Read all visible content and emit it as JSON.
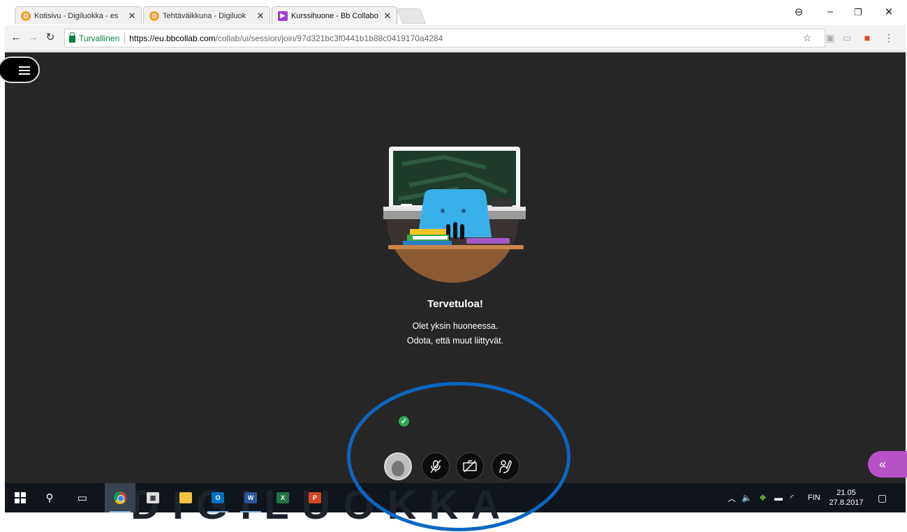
{
  "browser": {
    "tabs": [
      {
        "title": "Kotisivu - Digiluokka - es",
        "favicon": "digiluokka-icon"
      },
      {
        "title": "Tehtäväikkuna - Digiluok",
        "favicon": "digiluokka-icon"
      },
      {
        "title": "Kurssihuone - Bb Collabo",
        "favicon": "bb-collaborate-icon",
        "active": true
      }
    ],
    "close_glyph": "✕",
    "security_label": "Turvallinen",
    "url_host": "https://eu.bbcollab.com",
    "url_path": "/collab/ui/session/join/97d321bc3f0441b1b88c0419170a4284"
  },
  "collaborate": {
    "welcome_title": "Tervetuloa!",
    "welcome_line1": "Olet yksin huoneessa.",
    "welcome_line2": "Odota, että muut liittyvät.",
    "controls": [
      "avatar",
      "microphone-muted",
      "camera-off",
      "raise-hand"
    ],
    "panel_toggle": "«"
  },
  "taskbar": {
    "watermark": "DIGILUOKKA",
    "apps": [
      "chrome",
      "calculator",
      "file-explorer",
      "outlook",
      "word",
      "excel",
      "powerpoint"
    ],
    "language": "FIN",
    "time": "21.05",
    "date": "27.8.2017"
  },
  "colors": {
    "page_background": "#262626",
    "panel_accent": "#b651c6",
    "annotation": "#0b66c2",
    "secure_green": "#0b8043"
  }
}
